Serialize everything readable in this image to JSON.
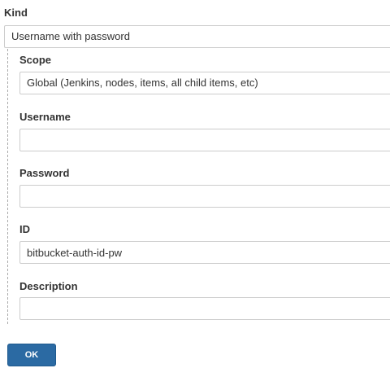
{
  "kind": {
    "label": "Kind",
    "selected": "Username with password"
  },
  "scope": {
    "label": "Scope",
    "selected": "Global (Jenkins, nodes, items, all child items, etc)"
  },
  "username": {
    "label": "Username",
    "value": ""
  },
  "password": {
    "label": "Password",
    "value": ""
  },
  "id": {
    "label": "ID",
    "value": "bitbucket-auth-id-pw"
  },
  "description": {
    "label": "Description",
    "value": ""
  },
  "ok_button": {
    "label": "OK"
  },
  "colors": {
    "button_bg": "#2b6aa3",
    "text": "#333333",
    "border": "#cccccc"
  }
}
